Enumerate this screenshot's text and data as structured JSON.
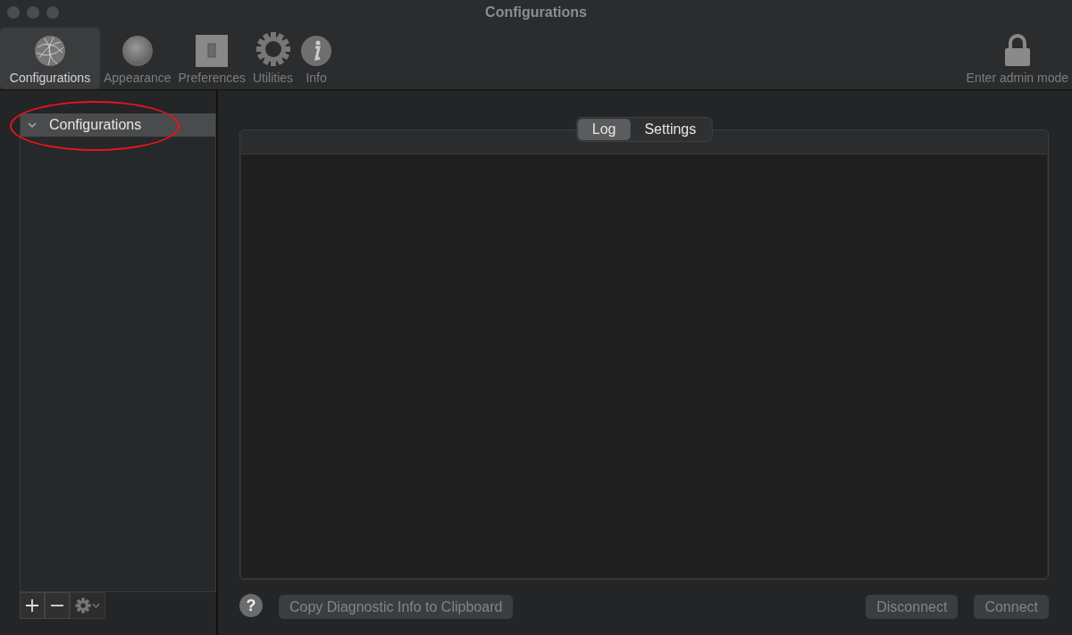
{
  "window": {
    "title": "Configurations"
  },
  "toolbar": {
    "items": [
      {
        "kind": "globe",
        "label": "Configurations",
        "selected": true
      },
      {
        "kind": "sphere",
        "label": "Appearance",
        "selected": false
      },
      {
        "kind": "switch",
        "label": "Preferences",
        "selected": false
      },
      {
        "kind": "gear",
        "label": "Utilities",
        "selected": false
      },
      {
        "kind": "info",
        "label": "Info",
        "selected": false
      }
    ],
    "admin": {
      "label": "Enter admin mode"
    }
  },
  "sidebar": {
    "items": [
      {
        "label": "Configurations",
        "expanded": true,
        "selected": true
      }
    ]
  },
  "tabs": [
    {
      "label": "Log",
      "selected": true
    },
    {
      "label": "Settings",
      "selected": false
    }
  ],
  "footer": {
    "help": "?",
    "copy_button": {
      "label": "Copy Diagnostic Info to Clipboard",
      "disabled": true
    },
    "buttons": [
      {
        "label": "Disconnect",
        "disabled": true
      },
      {
        "label": "Connect",
        "disabled": true
      }
    ]
  }
}
